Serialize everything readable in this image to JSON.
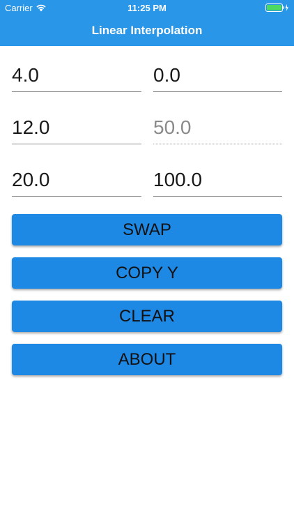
{
  "status_bar": {
    "carrier": "Carrier",
    "time": "11:25 PM"
  },
  "header": {
    "title": "Linear Interpolation",
    "color": "#2a96e8"
  },
  "fields": {
    "x1": "4.0",
    "y1": "0.0",
    "x": "12.0",
    "y": "50.0",
    "x2": "20.0",
    "y2": "100.0"
  },
  "buttons": {
    "swap": "SWAP",
    "copy_y": "COPY Y",
    "clear": "CLEAR",
    "about": "ABOUT",
    "color": "#1e88e5"
  }
}
